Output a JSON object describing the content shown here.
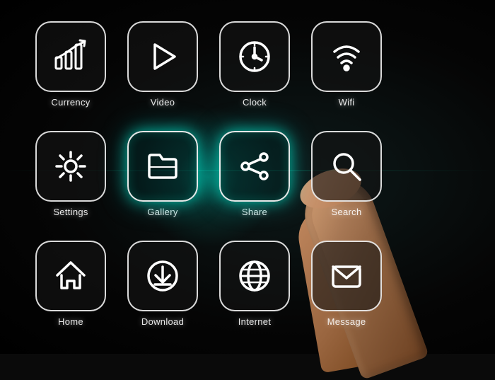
{
  "background": {
    "color": "#0a0a0a"
  },
  "apps": [
    {
      "id": "currency",
      "label": "Currency",
      "icon": "currency-icon",
      "row": 1,
      "col": 1,
      "glowing": false
    },
    {
      "id": "video",
      "label": "Video",
      "icon": "video-icon",
      "row": 1,
      "col": 2,
      "glowing": false
    },
    {
      "id": "clock",
      "label": "Clock",
      "icon": "clock-icon",
      "row": 1,
      "col": 3,
      "glowing": false
    },
    {
      "id": "wifi",
      "label": "Wifi",
      "icon": "wifi-icon",
      "row": 1,
      "col": 4,
      "glowing": false
    },
    {
      "id": "settings",
      "label": "Settings",
      "icon": "settings-icon",
      "row": 2,
      "col": 1,
      "glowing": false
    },
    {
      "id": "gallery",
      "label": "Gallery",
      "icon": "gallery-icon",
      "row": 2,
      "col": 2,
      "glowing": true
    },
    {
      "id": "share",
      "label": "Share",
      "icon": "share-icon",
      "row": 2,
      "col": 3,
      "glowing": true
    },
    {
      "id": "search",
      "label": "Search",
      "icon": "search-icon",
      "row": 2,
      "col": 4,
      "glowing": false
    },
    {
      "id": "home",
      "label": "Home",
      "icon": "home-icon",
      "row": 3,
      "col": 1,
      "glowing": false
    },
    {
      "id": "download",
      "label": "Download",
      "icon": "download-icon",
      "row": 3,
      "col": 2,
      "glowing": false
    },
    {
      "id": "internet",
      "label": "Internet",
      "icon": "internet-icon",
      "row": 3,
      "col": 3,
      "glowing": false
    },
    {
      "id": "message",
      "label": "Message",
      "icon": "message-icon",
      "row": 3,
      "col": 4,
      "glowing": false
    }
  ]
}
